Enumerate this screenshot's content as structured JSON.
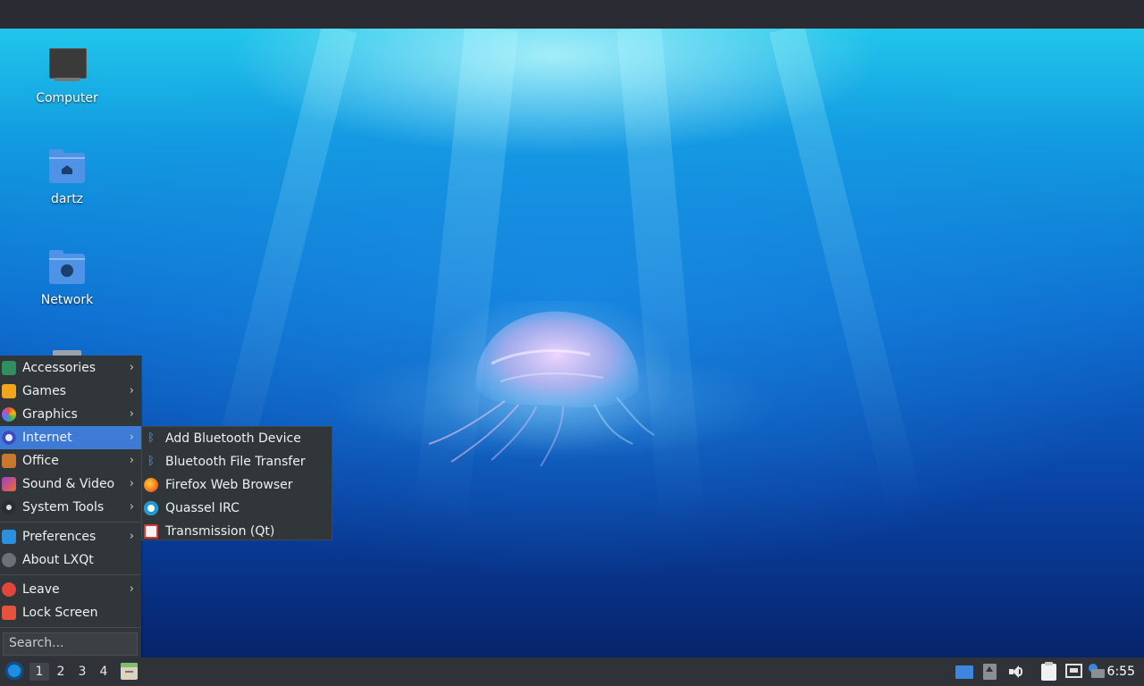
{
  "desktop": {
    "icons": [
      {
        "label": "Computer",
        "icon": "computer-icon"
      },
      {
        "label": "dartz",
        "icon": "home-folder-icon"
      },
      {
        "label": "Network",
        "icon": "network-folder-icon"
      },
      {
        "label": "",
        "icon": "trash-icon"
      }
    ]
  },
  "menu": {
    "items": [
      {
        "label": "Accessories",
        "icon": "accessories-icon",
        "submenu": true
      },
      {
        "label": "Games",
        "icon": "games-icon",
        "submenu": true
      },
      {
        "label": "Graphics",
        "icon": "graphics-icon",
        "submenu": true
      },
      {
        "label": "Internet",
        "icon": "internet-icon",
        "submenu": true,
        "active": true
      },
      {
        "label": "Office",
        "icon": "office-icon",
        "submenu": true
      },
      {
        "label": "Sound & Video",
        "icon": "sound-video-icon",
        "submenu": true
      },
      {
        "label": "System Tools",
        "icon": "system-tools-icon",
        "submenu": true
      },
      {
        "label": "Preferences",
        "icon": "preferences-icon",
        "submenu": true
      },
      {
        "label": "About LXQt",
        "icon": "info-icon",
        "submenu": false
      },
      {
        "label": "Leave",
        "icon": "power-icon",
        "submenu": true
      },
      {
        "label": "Lock Screen",
        "icon": "lock-icon",
        "submenu": false
      }
    ],
    "search_placeholder": "Search...",
    "arrow": "›"
  },
  "internet_submenu": {
    "items": [
      {
        "label": "Add Bluetooth Device",
        "icon": "bluetooth-icon"
      },
      {
        "label": "Bluetooth File Transfer",
        "icon": "bluetooth-icon"
      },
      {
        "label": "Firefox Web Browser",
        "icon": "firefox-icon"
      },
      {
        "label": "Quassel IRC",
        "icon": "quassel-icon"
      },
      {
        "label": "Transmission (Qt)",
        "icon": "transmission-icon"
      }
    ]
  },
  "taskbar": {
    "workspaces": [
      "1",
      "2",
      "3",
      "4"
    ],
    "active_workspace": "1",
    "clock": "6:55"
  },
  "colors": {
    "menu_bg": "#31363b",
    "highlight": "#3d7bd6",
    "taskbar_bg": "#2f3237"
  }
}
